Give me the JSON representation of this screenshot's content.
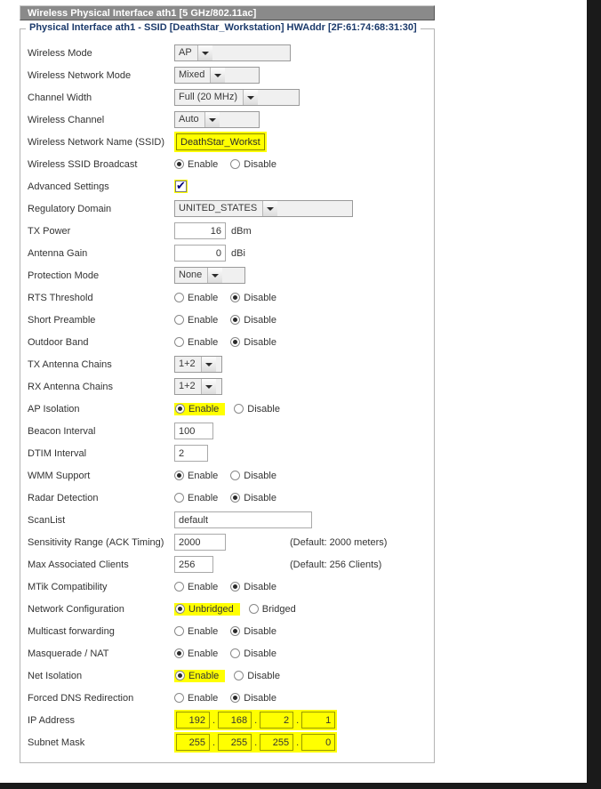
{
  "window": {
    "title": "Wireless Physical Interface ath1 [5 GHz/802.11ac]"
  },
  "fieldset": {
    "legend": "Physical Interface ath1 - SSID [DeathStar_Workstation] HWAddr [2F:61:74:68:31:30]"
  },
  "labels": {
    "wireless_mode": "Wireless Mode",
    "wireless_network_mode": "Wireless Network Mode",
    "channel_width": "Channel Width",
    "wireless_channel": "Wireless Channel",
    "ssid": "Wireless Network Name (SSID)",
    "ssid_broadcast": "Wireless SSID Broadcast",
    "advanced_settings": "Advanced Settings",
    "regulatory_domain": "Regulatory Domain",
    "tx_power": "TX Power",
    "antenna_gain": "Antenna Gain",
    "protection_mode": "Protection Mode",
    "rts_threshold": "RTS Threshold",
    "short_preamble": "Short Preamble",
    "outdoor_band": "Outdoor Band",
    "tx_antenna_chains": "TX Antenna Chains",
    "rx_antenna_chains": "RX Antenna Chains",
    "ap_isolation": "AP Isolation",
    "beacon_interval": "Beacon Interval",
    "dtim_interval": "DTIM Interval",
    "wmm_support": "WMM Support",
    "radar_detection": "Radar Detection",
    "scanlist": "ScanList",
    "sensitivity_range": "Sensitivity Range (ACK Timing)",
    "max_associated_clients": "Max Associated Clients",
    "mtik_compatibility": "MTik Compatibility",
    "network_configuration": "Network Configuration",
    "multicast_forwarding": "Multicast forwarding",
    "masquerade_nat": "Masquerade / NAT",
    "net_isolation": "Net Isolation",
    "forced_dns_redirection": "Forced DNS Redirection",
    "ip_address": "IP Address",
    "subnet_mask": "Subnet Mask"
  },
  "values": {
    "wireless_mode": "AP",
    "wireless_network_mode": "Mixed",
    "channel_width": "Full (20 MHz)",
    "wireless_channel": "Auto",
    "ssid": "DeathStar_Workstatio",
    "regulatory_domain": "UNITED_STATES",
    "tx_power": "16",
    "tx_power_unit": "dBm",
    "antenna_gain": "0",
    "antenna_gain_unit": "dBi",
    "protection_mode": "None",
    "tx_antenna_chains": "1+2",
    "rx_antenna_chains": "1+2",
    "beacon_interval": "100",
    "dtim_interval": "2",
    "scanlist": "default",
    "sensitivity_range": "2000",
    "sensitivity_hint": "(Default: 2000 meters)",
    "max_associated_clients": "256",
    "max_clients_hint": "(Default: 256 Clients)",
    "ip_address": [
      "192",
      "168",
      "2",
      "1"
    ],
    "subnet_mask": [
      "255",
      "255",
      "255",
      "0"
    ]
  },
  "options": {
    "enable": "Enable",
    "disable": "Disable",
    "unbridged": "Unbridged",
    "bridged": "Bridged"
  },
  "states": {
    "ssid_broadcast": "enable",
    "advanced_settings": true,
    "rts_threshold": "disable",
    "short_preamble": "disable",
    "outdoor_band": "disable",
    "ap_isolation": "enable",
    "wmm_support": "enable",
    "radar_detection": "disable",
    "mtik_compatibility": "disable",
    "network_configuration": "unbridged",
    "multicast_forwarding": "disable",
    "masquerade_nat": "enable",
    "net_isolation": "enable",
    "forced_dns_redirection": "disable"
  },
  "colors": {
    "highlight": "#ffff00",
    "titlebar": "#8a8a8a",
    "legend_text": "#1b3a6b"
  }
}
